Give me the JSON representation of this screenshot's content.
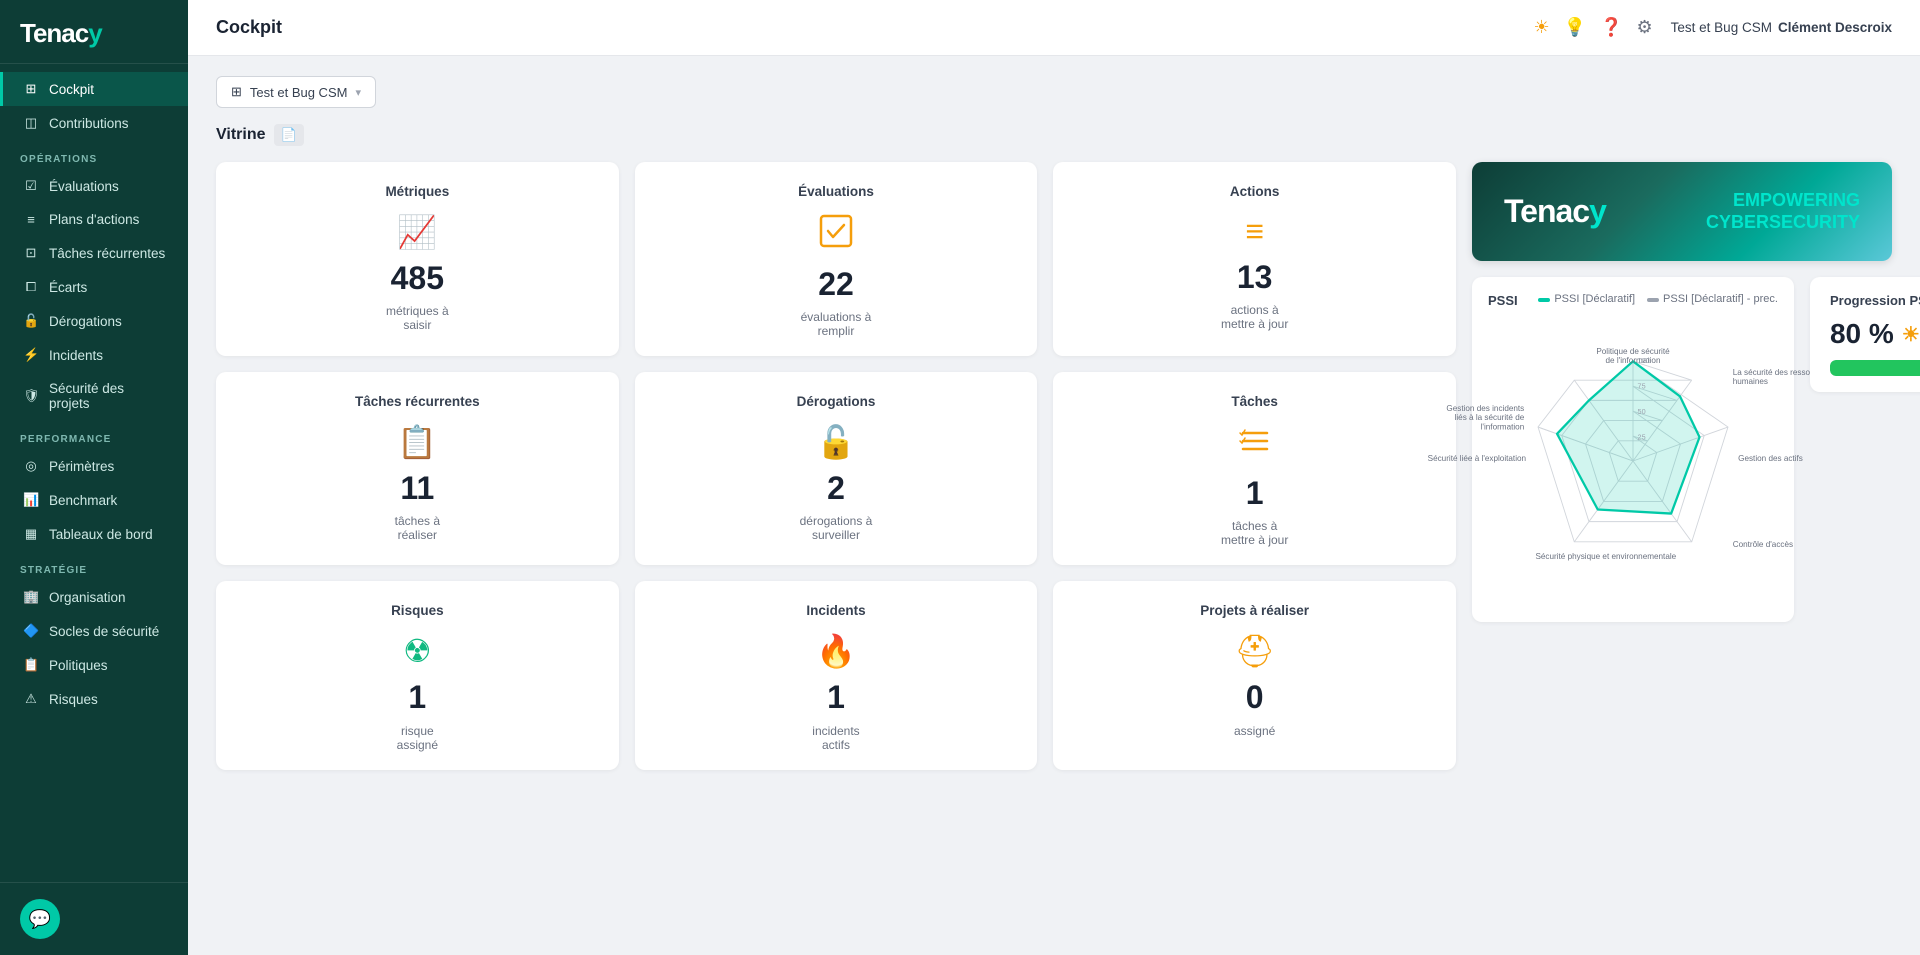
{
  "app": {
    "name": "Tenacy",
    "name_suffix": "y"
  },
  "topbar": {
    "title": "Cockpit",
    "org": "Test et Bug CSM",
    "user": "Clément Descroix"
  },
  "sidebar": {
    "sections": [
      {
        "label": null,
        "items": [
          {
            "id": "cockpit",
            "label": "Cockpit",
            "icon": "⊞",
            "active": true
          },
          {
            "id": "contributions",
            "label": "Contributions",
            "icon": "◫",
            "active": false
          }
        ]
      },
      {
        "label": "OPÉRATIONS",
        "items": [
          {
            "id": "evaluations",
            "label": "Évaluations",
            "icon": "☑",
            "active": false
          },
          {
            "id": "plans-actions",
            "label": "Plans d'actions",
            "icon": "≡",
            "active": false
          },
          {
            "id": "taches-recurrentes",
            "label": "Tâches récurrentes",
            "icon": "⊡",
            "active": false
          },
          {
            "id": "ecarts",
            "label": "Écarts",
            "icon": "⧠",
            "active": false
          },
          {
            "id": "derogations",
            "label": "Dérogations",
            "icon": "🔓",
            "active": false
          },
          {
            "id": "incidents",
            "label": "Incidents",
            "icon": "⚡",
            "active": false
          },
          {
            "id": "securite-projets",
            "label": "Sécurité des projets",
            "icon": "🛡",
            "active": false
          }
        ]
      },
      {
        "label": "PERFORMANCE",
        "items": [
          {
            "id": "perimetres",
            "label": "Périmètres",
            "icon": "◎",
            "active": false
          },
          {
            "id": "benchmark",
            "label": "Benchmark",
            "icon": "📊",
            "active": false
          },
          {
            "id": "tableaux-bord",
            "label": "Tableaux de bord",
            "icon": "▦",
            "active": false
          }
        ]
      },
      {
        "label": "STRATÉGIE",
        "items": [
          {
            "id": "organisation",
            "label": "Organisation",
            "icon": "🏢",
            "active": false
          },
          {
            "id": "socles-securite",
            "label": "Socles de sécurité",
            "icon": "🔷",
            "active": false
          },
          {
            "id": "politiques",
            "label": "Politiques",
            "icon": "📋",
            "active": false
          },
          {
            "id": "risques",
            "label": "Risques",
            "icon": "⚠",
            "active": false
          }
        ]
      }
    ]
  },
  "filter": {
    "dropdown_label": "Test et Bug CSM",
    "dropdown_icon": "⊞"
  },
  "vitrine": {
    "label": "Vitrine"
  },
  "cards": {
    "row1": [
      {
        "title": "Métriques",
        "icon": "📈",
        "number": "485",
        "subtitle": "métriques à\nsaisir",
        "color": "yellow"
      },
      {
        "title": "Évaluations",
        "icon": "☑",
        "number": "22",
        "subtitle": "évaluations à\nremplir",
        "color": "yellow"
      },
      {
        "title": "Actions",
        "icon": "≡",
        "number": "13",
        "subtitle": "actions à\nmettre à jour",
        "color": "yellow"
      }
    ],
    "row2": [
      {
        "title": "Tâches récurrentes",
        "icon": "📋",
        "number": "11",
        "subtitle": "tâches à\nréaliser",
        "color": "yellow"
      },
      {
        "title": "Dérogations",
        "icon": "🔓",
        "number": "2",
        "subtitle": "dérogations à\nsurveiller",
        "color": "yellow"
      },
      {
        "title": "Tâches",
        "icon": "☰",
        "number": "1",
        "subtitle": "tâches à\nmettre à jour",
        "color": "yellow"
      }
    ],
    "row3": [
      {
        "title": "Risques",
        "icon": "☢",
        "number": "1",
        "subtitle": "risque\nassigné",
        "color": "green"
      },
      {
        "title": "Incidents",
        "icon": "🔥",
        "number": "1",
        "subtitle": "incidents\nactifs",
        "color": "orange"
      },
      {
        "title": "Projets à réaliser",
        "icon": "⛑",
        "number": "0",
        "subtitle": "assigné",
        "color": "yellow"
      }
    ]
  },
  "banner": {
    "logo": "Tenac",
    "logo_suffix": "y",
    "tagline_line1": "EMPOWERING",
    "tagline_line2": "CYBERSECURITY"
  },
  "pssi": {
    "title": "PSSI",
    "legend": [
      {
        "label": "PSSI [Déclaratif]",
        "color": "cyan"
      },
      {
        "label": "PSSI [Déclaratif] - prec.",
        "color": "gray"
      }
    ],
    "radar_labels": [
      "Politique de sécurité\nde l'information",
      "La sécurité des ressources\nhumaines",
      "Gestion des actifs",
      "Contrôle d'accès",
      "Sécurité physique et environnementale",
      "Sécurité liée à l'exploitation",
      "Gestion des incidents\nliés à la sécurité de\nl'information"
    ]
  },
  "progression": {
    "title": "Progression PSSI",
    "value": "80 %",
    "percent": 80
  }
}
